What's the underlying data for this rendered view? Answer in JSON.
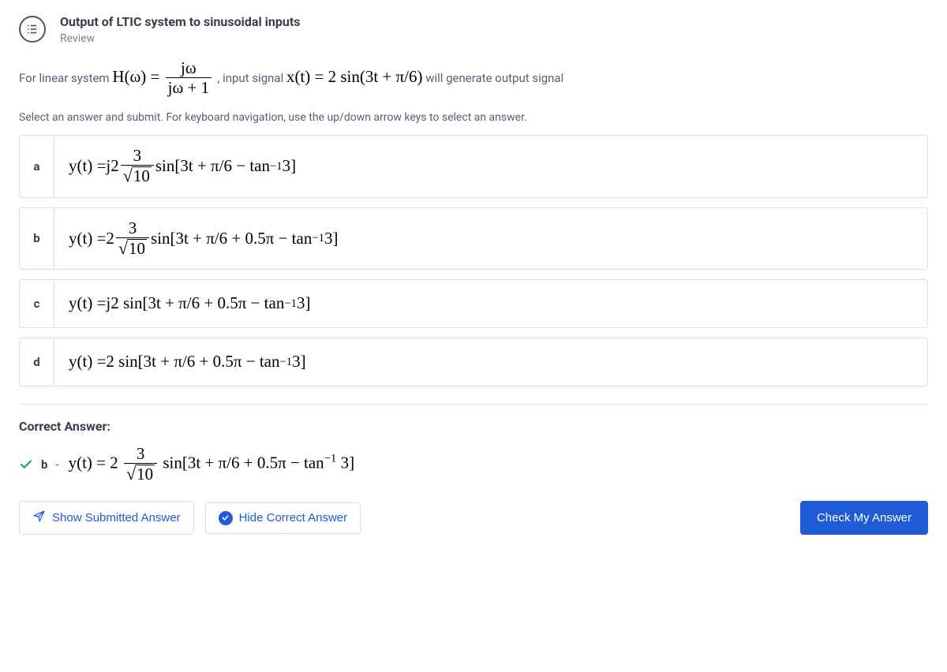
{
  "header": {
    "title": "Output of LTIC system to sinusoidal inputs",
    "subtitle": "Review"
  },
  "question": {
    "pre": "For linear system ",
    "mid": ", input signal ",
    "post": " will generate output signal",
    "H_label": "H(ω) = ",
    "frac_num": "jω",
    "frac_den": "jω + 1",
    "x_label": "x(t) = 2 sin(3t + π/6)"
  },
  "instruction": "Select an answer and submit. For keyboard navigation, use the up/down arrow keys to select an answer.",
  "answers": {
    "a": {
      "letter": "a"
    },
    "b": {
      "letter": "b"
    },
    "c": {
      "letter": "c"
    },
    "d": {
      "letter": "d"
    }
  },
  "math_parts": {
    "y_eq": "y(t) = ",
    "j2": "j2",
    "two": "2",
    "three": "3",
    "ten": "10",
    "sin_open": " sin[3t + π/6 − tan",
    "sin_open_half": " sin[3t + π/6 + 0.5π − tan",
    "neg1": "−1",
    "close3": " 3]",
    "j2sin": "j2 sin[3t + π/6 + 0.5π − tan",
    "twosin": "2 sin[3t + π/6 + 0.5π − tan"
  },
  "correct": {
    "heading": "Correct Answer:",
    "letter": "b",
    "dash": "-"
  },
  "buttons": {
    "show_submitted": "Show Submitted Answer",
    "hide_correct": "Hide Correct Answer",
    "check": "Check My Answer"
  }
}
